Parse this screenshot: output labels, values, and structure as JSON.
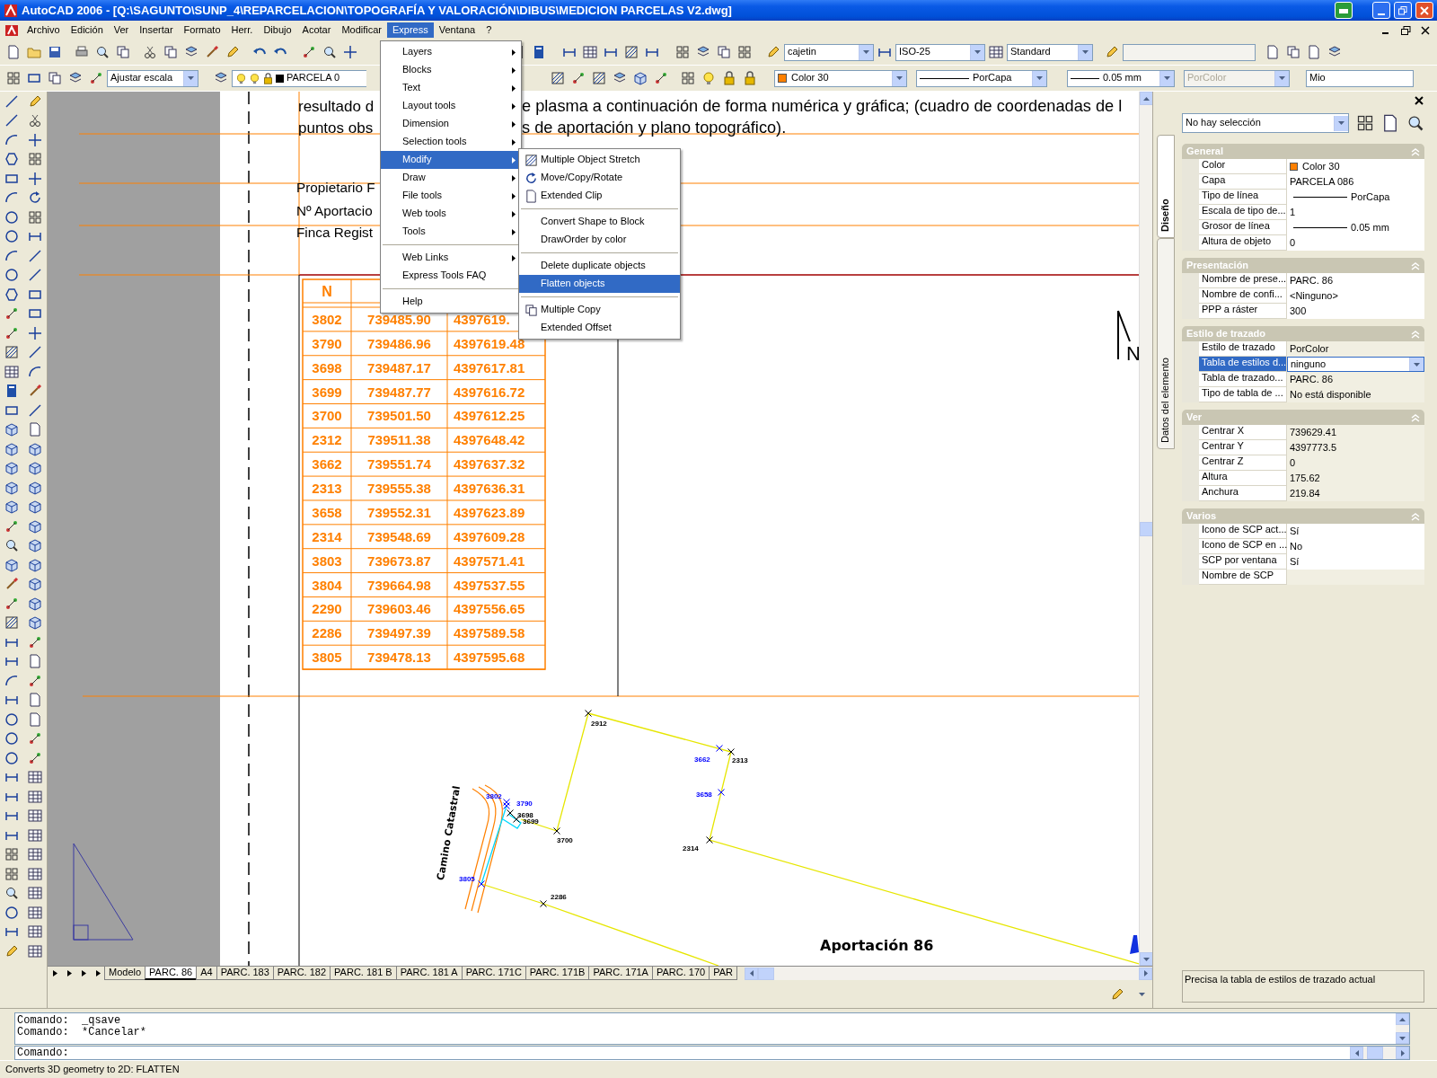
{
  "window": {
    "title": "AutoCAD 2006 - [Q:\\SAGUNTO\\SUNP_4\\REPARCELACION\\TOPOGRAFÍA Y VALORACIÓN\\DIBUS\\MEDICION PARCELAS V2.dwg]"
  },
  "menu_bar": {
    "items": [
      {
        "label": "Archivo",
        "selected": false
      },
      {
        "label": "Edición",
        "selected": false
      },
      {
        "label": "Ver",
        "selected": false
      },
      {
        "label": "Insertar",
        "selected": false
      },
      {
        "label": "Formato",
        "selected": false
      },
      {
        "label": "Herr.",
        "selected": false
      },
      {
        "label": "Dibujo",
        "selected": false
      },
      {
        "label": "Acotar",
        "selected": false
      },
      {
        "label": "Modificar",
        "selected": false
      },
      {
        "label": "Express",
        "selected": true
      },
      {
        "label": "Ventana",
        "selected": false
      },
      {
        "label": "?",
        "selected": false
      }
    ]
  },
  "express_menu": {
    "items": [
      {
        "kind": "item",
        "label": "Layers",
        "submenu": true,
        "selected": false
      },
      {
        "kind": "item",
        "label": "Blocks",
        "submenu": true,
        "selected": false
      },
      {
        "kind": "item",
        "label": "Text",
        "submenu": true,
        "selected": false
      },
      {
        "kind": "item",
        "label": "Layout tools",
        "submenu": true,
        "selected": false
      },
      {
        "kind": "item",
        "label": "Dimension",
        "submenu": true,
        "selected": false
      },
      {
        "kind": "item",
        "label": "Selection tools",
        "submenu": true,
        "selected": false
      },
      {
        "kind": "item",
        "label": "Modify",
        "submenu": true,
        "selected": true
      },
      {
        "kind": "item",
        "label": "Draw",
        "submenu": true,
        "selected": false
      },
      {
        "kind": "item",
        "label": "File tools",
        "submenu": true,
        "selected": false
      },
      {
        "kind": "item",
        "label": "Web tools",
        "submenu": true,
        "selected": false
      },
      {
        "kind": "item",
        "label": "Tools",
        "submenu": true,
        "selected": false
      },
      {
        "kind": "separator"
      },
      {
        "kind": "item",
        "label": "Web Links",
        "submenu": true,
        "selected": false
      },
      {
        "kind": "item",
        "label": "Express Tools FAQ",
        "submenu": false,
        "selected": false
      },
      {
        "kind": "separator"
      },
      {
        "kind": "item",
        "label": "Help",
        "submenu": false,
        "selected": false
      }
    ]
  },
  "modify_submenu": {
    "items": [
      {
        "kind": "icon_item",
        "label": "Multiple Object Stretch",
        "selected": false
      },
      {
        "kind": "icon_item",
        "label": "Move/Copy/Rotate",
        "selected": false
      },
      {
        "kind": "icon_item",
        "label": "Extended Clip",
        "selected": false
      },
      {
        "kind": "separator"
      },
      {
        "kind": "item",
        "label": "Convert Shape to Block",
        "selected": false
      },
      {
        "kind": "item",
        "label": "DrawOrder by color",
        "selected": false
      },
      {
        "kind": "separator"
      },
      {
        "kind": "item",
        "label": "Delete duplicate objects",
        "selected": false
      },
      {
        "kind": "item",
        "label": "Flatten objects",
        "selected": true
      },
      {
        "kind": "separator"
      },
      {
        "kind": "icon_item",
        "label": "Multiple Copy",
        "selected": false
      },
      {
        "kind": "item",
        "label": "Extended Offset",
        "selected": false
      }
    ]
  },
  "toolbars": {
    "text_style": "cajetin",
    "dim_style": "ISO-25",
    "table_style": "Standard",
    "scale": "Ajustar escala",
    "layer": "PARCELA 0",
    "color": {
      "label": "Color 30",
      "color": "#ff8000"
    },
    "linetype": "PorCapa",
    "lineweight": "0.05 mm",
    "plot_style": {
      "label": "PorColor",
      "disabled": true
    },
    "named_view": "Mio"
  },
  "drawing": {
    "sheet_text": [
      "resultado d",
      "e plasma a continuación de forma numérica y gráfica; (cuadro de coordenadas de l",
      "puntos obs",
      "s de aportación y plano topográfico).",
      "Propietario F",
      "Nº Aportacio",
      "Finca Regist"
    ],
    "table": {
      "header": [
        "N"
      ],
      "rows": [
        [
          "3802",
          "739485.90",
          "4397619."
        ],
        [
          "3790",
          "739486.96",
          "4397619.48"
        ],
        [
          "3698",
          "739487.17",
          "4397617.81"
        ],
        [
          "3699",
          "739487.77",
          "4397616.72"
        ],
        [
          "3700",
          "739501.50",
          "4397612.25"
        ],
        [
          "2312",
          "739511.38",
          "4397648.42"
        ],
        [
          "3662",
          "739551.74",
          "4397637.32"
        ],
        [
          "2313",
          "739555.38",
          "4397636.31"
        ],
        [
          "3658",
          "739552.31",
          "4397623.89"
        ],
        [
          "2314",
          "739548.69",
          "4397609.28"
        ],
        [
          "3803",
          "739673.87",
          "4397571.41"
        ],
        [
          "3804",
          "739664.98",
          "4397537.55"
        ],
        [
          "2290",
          "739603.46",
          "4397556.65"
        ],
        [
          "2286",
          "739497.39",
          "4397589.58"
        ],
        [
          "3805",
          "739478.13",
          "4397595.68"
        ]
      ]
    },
    "north_label": "N",
    "plot": {
      "points": [
        {
          "label": "2912",
          "color": "#000000"
        },
        {
          "label": "3662",
          "color": "#0000ff"
        },
        {
          "label": "2313",
          "color": "#000000"
        },
        {
          "label": "3658",
          "color": "#0000ff"
        },
        {
          "label": "2314",
          "color": "#000000"
        },
        {
          "label": "3802",
          "color": "#0000ff"
        },
        {
          "label": "3790",
          "color": "#0000ff"
        },
        {
          "label": "3698",
          "color": "#000000"
        },
        {
          "label": "3699",
          "color": "#000000"
        },
        {
          "label": "3700",
          "color": "#000000"
        },
        {
          "label": "3805",
          "color": "#0000ff"
        },
        {
          "label": "2286",
          "color": "#000000"
        }
      ],
      "road_label": "Camino Catastral",
      "title": "Aportación 86"
    }
  },
  "layout_tabs": [
    {
      "label": "Modelo",
      "selected": false
    },
    {
      "label": "PARC. 86",
      "selected": true
    },
    {
      "label": "A4",
      "selected": false
    },
    {
      "label": "PARC. 183",
      "selected": false
    },
    {
      "label": "PARC. 182",
      "selected": false
    },
    {
      "label": "PARC. 181 B",
      "selected": false
    },
    {
      "label": "PARC. 181 A",
      "selected": false
    },
    {
      "label": "PARC. 171C",
      "selected": false
    },
    {
      "label": "PARC. 171B",
      "selected": false
    },
    {
      "label": "PARC. 171A",
      "selected": false
    },
    {
      "label": "PARC. 170",
      "selected": false
    },
    {
      "label": "PAR",
      "selected": false
    }
  ],
  "properties": {
    "selection": "No hay selección",
    "tabs": [
      {
        "label": "Diseño",
        "selected": true
      },
      {
        "label": "Datos del elemento",
        "selected": false
      }
    ],
    "sections": [
      {
        "title": "General",
        "expanded": true,
        "rows": [
          {
            "kind": "color",
            "label": "Color",
            "value": "Color 30",
            "color": "#ff8000",
            "readonly": false,
            "selected": false
          },
          {
            "kind": "text",
            "label": "Capa",
            "value": "PARCELA 086",
            "readonly": false,
            "selected": false
          },
          {
            "kind": "line",
            "label": "Tipo de línea",
            "value": "PorCapa",
            "readonly": false,
            "selected": false
          },
          {
            "kind": "text",
            "label": "Escala de tipo de...",
            "value": "1",
            "readonly": false,
            "selected": false
          },
          {
            "kind": "line",
            "label": "Grosor de línea",
            "value": "0.05 mm",
            "readonly": false,
            "selected": false
          },
          {
            "kind": "text",
            "label": "Altura de objeto",
            "value": "0",
            "readonly": false,
            "selected": false
          }
        ]
      },
      {
        "title": "Presentación",
        "expanded": true,
        "rows": [
          {
            "kind": "text",
            "label": "Nombre de prese...",
            "value": "PARC. 86",
            "readonly": false,
            "selected": false
          },
          {
            "kind": "text",
            "label": "Nombre de confi...",
            "value": "<Ninguno>",
            "readonly": false,
            "selected": false
          },
          {
            "kind": "text",
            "label": "PPP a ráster",
            "value": "300",
            "readonly": false,
            "selected": false
          }
        ]
      },
      {
        "title": "Estilo de trazado",
        "expanded": true,
        "rows": [
          {
            "kind": "text",
            "label": "Estilo de trazado",
            "value": "PorColor",
            "readonly": true,
            "selected": false
          },
          {
            "kind": "dropdown",
            "label": "Tabla de estilos d...",
            "value": "ninguno",
            "readonly": false,
            "selected": true
          },
          {
            "kind": "text",
            "label": "Tabla de trazado...",
            "value": "PARC. 86",
            "readonly": true,
            "selected": false
          },
          {
            "kind": "text",
            "label": "Tipo de tabla de ...",
            "value": "No está disponible",
            "readonly": true,
            "selected": false
          }
        ]
      },
      {
        "title": "Ver",
        "expanded": true,
        "rows": [
          {
            "kind": "text",
            "label": "Centrar X",
            "value": "739629.41",
            "readonly": true,
            "selected": false
          },
          {
            "kind": "text",
            "label": "Centrar Y",
            "value": "4397773.5",
            "readonly": true,
            "selected": false
          },
          {
            "kind": "text",
            "label": "Centrar Z",
            "value": "0",
            "readonly": true,
            "selected": false
          },
          {
            "kind": "text",
            "label": "Altura",
            "value": "175.62",
            "readonly": true,
            "selected": false
          },
          {
            "kind": "text",
            "label": "Anchura",
            "value": "219.84",
            "readonly": true,
            "selected": false
          }
        ]
      },
      {
        "title": "Varios",
        "expanded": true,
        "rows": [
          {
            "kind": "text",
            "label": "Icono de SCP act...",
            "value": "Sí",
            "readonly": false,
            "selected": false
          },
          {
            "kind": "text",
            "label": "Icono de SCP en ...",
            "value": "No",
            "readonly": false,
            "selected": false
          },
          {
            "kind": "text",
            "label": "SCP por ventana",
            "value": "Sí",
            "readonly": false,
            "selected": false
          },
          {
            "kind": "text",
            "label": "Nombre de SCP",
            "value": "",
            "readonly": true,
            "selected": false
          }
        ]
      }
    ],
    "description": "Precisa la tabla de estilos de trazado actual"
  },
  "command_line": {
    "history": [
      "Comando:  _qsave",
      "Comando:  *Cancelar*"
    ],
    "prompt": "Comando:"
  },
  "status_bar": "Converts 3D geometry to 2D: FLATTEN"
}
